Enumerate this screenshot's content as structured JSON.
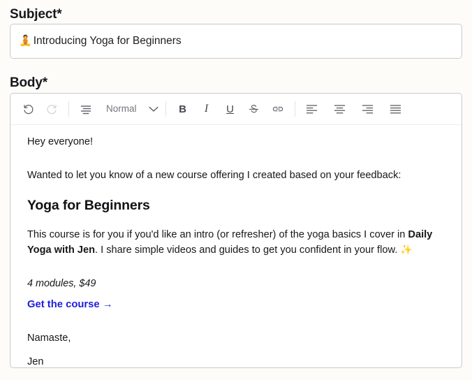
{
  "subject": {
    "label": "Subject*",
    "emoji": "🧘",
    "value": "Introducing Yoga for Beginners",
    "placeholder": "Subject"
  },
  "body": {
    "label": "Body*",
    "toolbar": {
      "undo": "undo-icon",
      "redo": "redo-icon",
      "paragraph": "paragraph-style-icon",
      "style_value": "Normal",
      "style_chevron": "chevron-down-icon",
      "bold": "B",
      "italic": "I",
      "underline": "U",
      "strikethrough": "S",
      "link": "link-icon",
      "align_left": "align-left-icon",
      "align_center": "align-center-icon",
      "align_right": "align-right-icon",
      "align_justify": "align-justify-icon"
    },
    "content": {
      "greeting": "Hey everyone!",
      "intro": "Wanted to let you know of a new course offering I created based on your feedback:",
      "heading": "Yoga for Beginners",
      "description_part1": "This course is for you if you'd like an intro (or refresher) of the yoga basics I cover in ",
      "description_bold": "Daily Yoga with Jen",
      "description_part2": ". I share simple videos and guides to get you confident in your flow. ",
      "description_emoji": "✨",
      "price_line": "4 modules, $49",
      "cta_link": "Get the course →",
      "signoff": "Namaste,",
      "signature": "Jen"
    }
  },
  "colors": {
    "page_background": "#fdfcf9",
    "field_border": "#cbcbcb",
    "link": "#1d1ddc",
    "text": "#15171a",
    "toolbar_icon": "#5d6168",
    "toolbar_icon_disabled": "#d2d4d7"
  }
}
